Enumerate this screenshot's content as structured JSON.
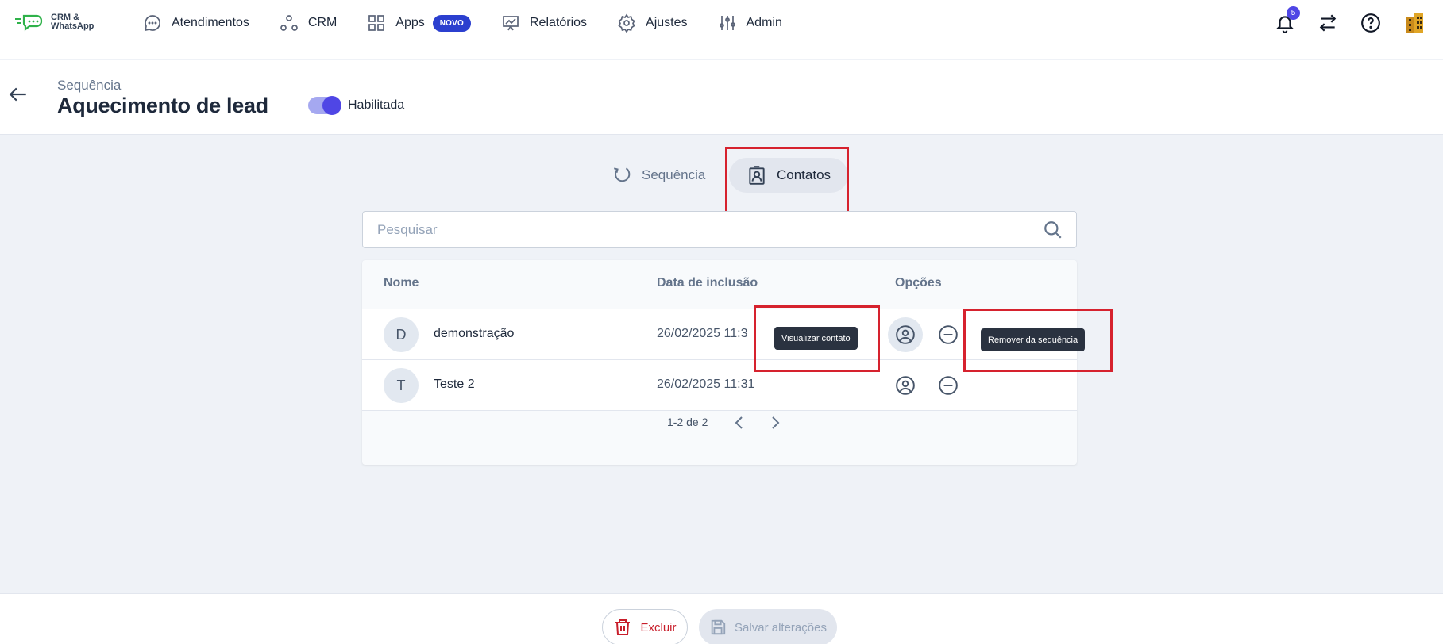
{
  "app": {
    "logo_line1": "CRM &",
    "logo_line2": "WhatsApp",
    "brand_color": "#2fb24a"
  },
  "nav": {
    "items": [
      {
        "label": "Atendimentos",
        "icon": "chat-bubble-icon"
      },
      {
        "label": "CRM",
        "icon": "nodes-icon"
      },
      {
        "label": "Apps",
        "icon": "grid-icon",
        "badge": "NOVO"
      },
      {
        "label": "Relatórios",
        "icon": "presentation-chart-icon"
      },
      {
        "label": "Ajustes",
        "icon": "gear-icon"
      },
      {
        "label": "Admin",
        "icon": "sliders-icon"
      }
    ],
    "notifications_count": "5"
  },
  "header": {
    "breadcrumb": "Sequência",
    "title": "Aquecimento de lead",
    "toggle_label": "Habilitada",
    "toggle_on": true,
    "accent": "#4f46e5"
  },
  "tabs": [
    {
      "label": "Sequência",
      "icon": "loop-arrows-icon",
      "active": false
    },
    {
      "label": "Contatos",
      "icon": "contact-badge-icon",
      "active": true
    }
  ],
  "search": {
    "placeholder": "Pesquisar",
    "value": ""
  },
  "table": {
    "headers": {
      "name": "Nome",
      "date": "Data de inclusão",
      "options": "Opções"
    },
    "rows": [
      {
        "initial": "D",
        "name": "demonstração",
        "date": "26/02/2025 11:3"
      },
      {
        "initial": "T",
        "name": "Teste 2",
        "date": "26/02/2025 11:31"
      }
    ],
    "pagination": "1-2 de 2"
  },
  "tooltips": {
    "view_contact": "Visualizar contato",
    "remove_from_sequence": "Remover da sequência"
  },
  "footer": {
    "delete_label": "Excluir",
    "save_label": "Salvar alterações"
  },
  "highlight_color": "#d6222e"
}
